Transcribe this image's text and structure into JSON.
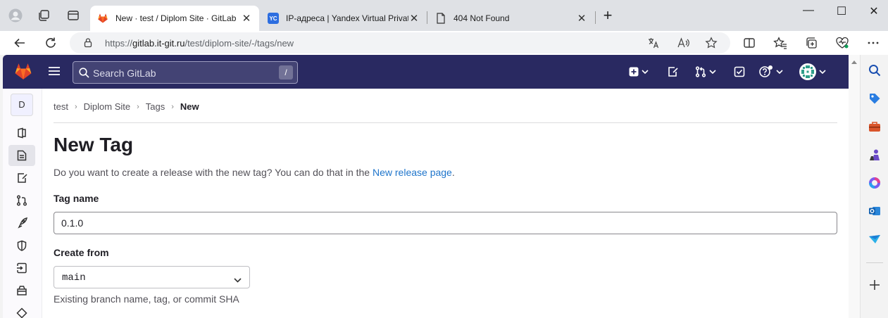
{
  "browser": {
    "tabs": [
      {
        "title": "New · test / Diplom Site · GitLab",
        "favicon": "gitlab-icon",
        "active": true
      },
      {
        "title": "IP-адреса | Yandex Virtual Private",
        "favicon": "yandex-cloud-icon",
        "favicon_text": "YC",
        "active": false
      },
      {
        "title": "404 Not Found",
        "favicon": "page-icon",
        "active": false
      }
    ],
    "close_glyph": "✕",
    "new_tab_glyph": "+",
    "window_controls": {
      "minimize": "—",
      "maximize": "☐",
      "close": "✕"
    },
    "address": {
      "scheme": "https://",
      "host": "gitlab.it-git.ru",
      "path": "/test/diplom-site/-/tags/new"
    }
  },
  "gitlab": {
    "colors": {
      "header_bg": "#292961",
      "link": "#1f75cb"
    },
    "search": {
      "placeholder": "Search GitLab",
      "shortcut": "/"
    },
    "project_avatar": "D",
    "breadcrumbs": [
      "test",
      "Diplom Site",
      "Tags",
      "New"
    ],
    "breadcrumb_separator": "›",
    "page_title": "New Tag",
    "description_prefix": "Do you want to create a release with the new tag? You can do that in the ",
    "description_link": "New release page",
    "description_suffix": ".",
    "tag_name_label": "Tag name",
    "tag_name_value": "0.1.0",
    "create_from_label": "Create from",
    "create_from_value": "main",
    "create_from_help": "Existing branch name, tag, or commit SHA"
  }
}
